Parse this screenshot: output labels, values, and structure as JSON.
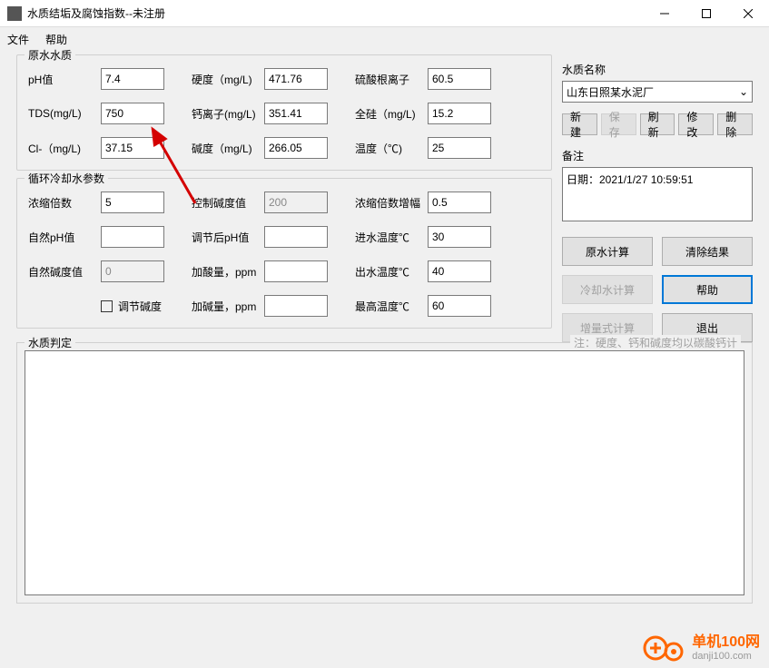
{
  "window": {
    "title": "水质结垢及腐蚀指数--未注册"
  },
  "menubar": {
    "file": "文件",
    "help": "帮助"
  },
  "groups": {
    "raw_water": "原水水质",
    "cooling": "循环冷却水参数",
    "judgment": "水质判定"
  },
  "raw_water": {
    "ph_label": "pH值",
    "ph_value": "7.4",
    "tds_label": "TDS(mg/L)",
    "tds_value": "750",
    "cl_label": "Cl-（mg/L)",
    "cl_value": "37.15",
    "hardness_label": "硬度（mg/L)",
    "hardness_value": "471.76",
    "calcium_label": "钙离子(mg/L)",
    "calcium_value": "351.41",
    "alkalinity_label": "碱度（mg/L)",
    "alkalinity_value": "266.05",
    "sulfate_label": "硫酸根离子",
    "sulfate_value": "60.5",
    "silicon_label": "全硅（mg/L)",
    "silicon_value": "15.2",
    "temp_label": "温度（℃)",
    "temp_value": "25"
  },
  "cooling": {
    "ratio_label": "浓缩倍数",
    "ratio_value": "5",
    "natph_label": "自然pH值",
    "natph_value": "",
    "natalk_label": "自然碱度值",
    "natalk_value": "0",
    "adjust_alk_label": "调节碱度",
    "ctrl_alk_label": "控制碱度值",
    "ctrl_alk_value": "200",
    "adj_ph_label": "调节后pH值",
    "adj_ph_value": "",
    "acid_label": "加酸量，ppm",
    "acid_value": "",
    "alkali_label": "加碱量，ppm",
    "alkali_value": "",
    "ratio_inc_label": "浓缩倍数增幅",
    "ratio_inc_value": "0.5",
    "in_temp_label": "进水温度℃",
    "in_temp_value": "30",
    "out_temp_label": "出水温度℃",
    "out_temp_value": "40",
    "max_temp_label": "最高温度℃",
    "max_temp_value": "60"
  },
  "right": {
    "name_label": "水质名称",
    "name_value": "山东日照某水泥厂",
    "buttons": {
      "new": "新建",
      "save": "保存",
      "refresh": "刷新",
      "edit": "修改",
      "delete": "删除"
    },
    "memo_label": "备注",
    "memo_value": "日期：2021/1/27 10:59:51",
    "big_buttons": {
      "raw_calc": "原水计算",
      "clear": "清除结果",
      "cool_calc": "冷却水计算",
      "help": "帮助",
      "inc_calc": "增量式计算",
      "exit": "退出"
    }
  },
  "judgment_hint": "注：硬度、钙和碱度均以碳酸钙计",
  "watermark": {
    "brand": "单机100网",
    "url": "danji100.com"
  }
}
